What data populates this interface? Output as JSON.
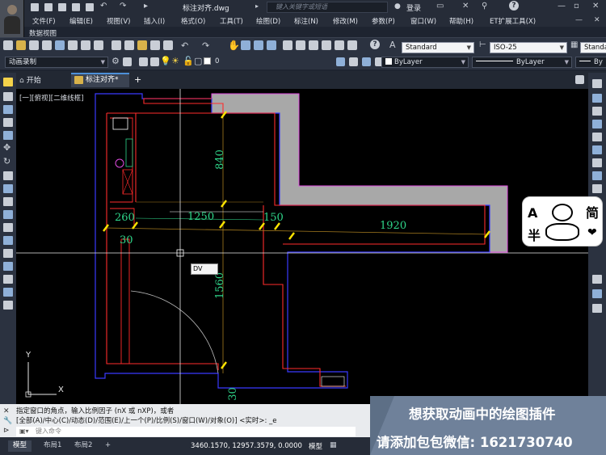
{
  "titlebar": {
    "document_title": "标注对齐.dwg",
    "search_placeholder": "键入关键字或短语",
    "login_label": "登录",
    "help_label": "?"
  },
  "menus": [
    "文件(F)",
    "编辑(E)",
    "视图(V)",
    "插入(I)",
    "格式(O)",
    "工具(T)",
    "绘图(D)",
    "标注(N)",
    "修改(M)",
    "参数(P)",
    "窗口(W)",
    "帮助(H)",
    "ET扩展工具(X)"
  ],
  "sub_label": "数据视图",
  "toolbar": {
    "text_style": "Standard",
    "dim_style": "ISO-25",
    "table_style": "Standa",
    "workspace": "动画录制",
    "layer": "0",
    "color": "ByLayer",
    "linetype": "ByLayer",
    "lineweight": "By"
  },
  "tabs": {
    "start": "开始",
    "document": "标注对齐*",
    "add": "+"
  },
  "viewport": {
    "label": "[一][俯视][二维线框]",
    "dims": [
      "840",
      "260",
      "1250",
      "150",
      "1920",
      "30",
      "1560",
      "30"
    ],
    "dynamic_input": "DV",
    "ucs_x": "X",
    "ucs_y": "Y"
  },
  "command": {
    "line1": "指定窗口的角点，输入比例因子 (nX 或 nXP)，或者",
    "line2": "[全部(A)/中心(C)/动态(D)/范围(E)/上一个(P)/比例(S)/窗口(W)/对象(O)] <实时>: _e",
    "input_placeholder": "键入命令"
  },
  "status": {
    "tab_model": "模型",
    "tab_layout1": "布局1",
    "tab_layout2": "布局2",
    "add": "+",
    "coords": "3460.1570, 12957.3579, 0.0000",
    "grid": "模型"
  },
  "promo": {
    "line1": "想获取动画中的绘图插件",
    "line2": "请添加包包微信: 1621730740"
  },
  "sticker": {
    "a": "A",
    "ban": "半",
    "jian": "简",
    "heart": "❤"
  },
  "colors": {
    "dim_text": "#2fd68a",
    "wall": "#ff2b2b",
    "outline": "#3a3aff",
    "magenta": "#e04be0",
    "highlight_gray": "#a8a8a8",
    "tick": "#ffe400",
    "accent": "#4d90d9"
  },
  "icons": [
    "undo-icon",
    "redo-icon",
    "pan-icon",
    "zoom-icon",
    "layer-icon",
    "bulb-icon",
    "sun-icon",
    "lock-icon"
  ]
}
